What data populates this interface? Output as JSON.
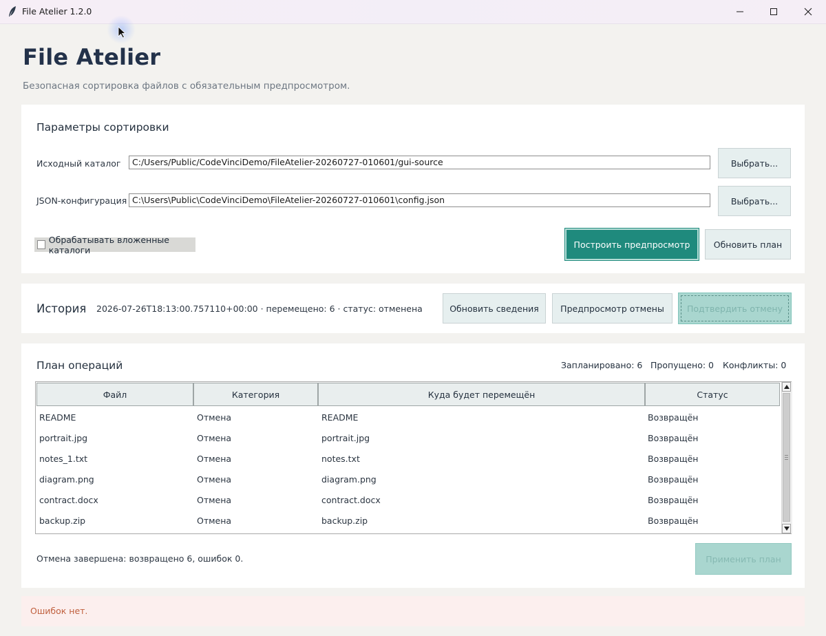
{
  "window": {
    "title": "File Atelier 1.2.0",
    "controls": {
      "minimize": "minimize-icon",
      "maximize": "maximize-icon",
      "close": "close-icon"
    }
  },
  "header": {
    "title": "File Atelier",
    "subtitle": "Безопасная сортировка файлов с обязательным предпросмотром."
  },
  "params": {
    "title": "Параметры сортировки",
    "source_label": "Исходный каталог",
    "source_value": "C:/Users/Public/CodeVinciDemo/FileAtelier-20260727-010601/gui-source",
    "config_label": "JSON-конфигурация",
    "config_value": "C:\\Users\\Public\\CodeVinciDemo\\FileAtelier-20260727-010601\\config.json",
    "browse_label": "Выбрать...",
    "recursive_label": "Обрабатывать вложенные каталоги",
    "recursive_checked": false,
    "build_preview_label": "Построить предпросмотр",
    "refresh_plan_label": "Обновить план"
  },
  "history": {
    "title": "История",
    "info": "2026-07-26T18:13:00.757110+00:00 · перемещено: 6 · статус: отменена",
    "refresh_label": "Обновить сведения",
    "undo_preview_label": "Предпросмотр отмены",
    "confirm_undo_label": "Подтвердить отмену"
  },
  "plan": {
    "title": "План операций",
    "stats": {
      "planned": "Запланировано: 6",
      "skipped": "Пропущено: 0",
      "conflicts": "Конфликты: 0"
    },
    "columns": [
      "Файл",
      "Категория",
      "Куда будет перемещён",
      "Статус"
    ],
    "rows": [
      [
        "README",
        "Отмена",
        "README",
        "Возвращён"
      ],
      [
        "portrait.jpg",
        "Отмена",
        "portrait.jpg",
        "Возвращён"
      ],
      [
        "notes_1.txt",
        "Отмена",
        "notes.txt",
        "Возвращён"
      ],
      [
        "diagram.png",
        "Отмена",
        "diagram.png",
        "Возвращён"
      ],
      [
        "contract.docx",
        "Отмена",
        "contract.docx",
        "Возвращён"
      ],
      [
        "backup.zip",
        "Отмена",
        "backup.zip",
        "Возвращён"
      ]
    ],
    "status_message": "Отмена завершена: возвращено 6, ошибок 0.",
    "apply_label": "Применить план"
  },
  "footer": {
    "error_text": "Ошибок нет."
  },
  "colors": {
    "accent": "#1f8a7d",
    "accent_disabled": "#a9d6cf",
    "error_text": "#c0603e",
    "title_text": "#23324a"
  }
}
